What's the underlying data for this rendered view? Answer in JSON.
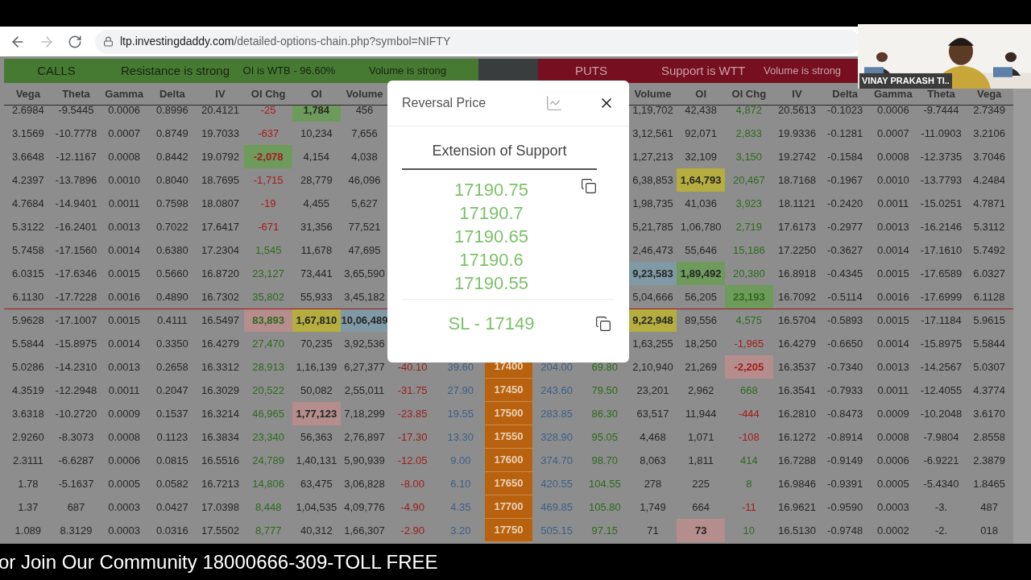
{
  "browser": {
    "url_host": "ltp.investingdaddy.com",
    "url_path": "/detailed-options-chain.php?symbol=NIFTY"
  },
  "calls_bar": [
    "CALLS",
    "Resistance is strong",
    "OI is WTB - 96.60%",
    "Volume is strong"
  ],
  "puts_bar": [
    "PUTS",
    "Support is WTT",
    "Volume is strong"
  ],
  "columns": [
    "Vega",
    "Theta",
    "Gamma",
    "Delta",
    "IV",
    "OI Chg",
    "OI",
    "Volume",
    null,
    null,
    null,
    null,
    null,
    "Volume",
    "OI",
    "OI Chg",
    "IV",
    "Delta",
    "Gamma",
    "Theta",
    "Vega"
  ],
  "rows": [
    {
      "line_above": false,
      "cells": [
        "2.6984",
        "-9.5445",
        "0.0006",
        "0.8996",
        "20.4121",
        {
          "text": "-25",
          "up": false
        },
        {
          "text": "1,784",
          "color": "#6e9a5c"
        },
        "456",
        null,
        null,
        null,
        null,
        null,
        "1,19,702",
        "42,438",
        {
          "text": "4,872",
          "up": true
        },
        "20.5613",
        "-0.1023",
        "0.0006",
        "-9.7444",
        "2.7349"
      ]
    },
    {
      "line_above": false,
      "cells": [
        "3.1569",
        "-10.7778",
        "0.0007",
        "0.8749",
        "19.7033",
        {
          "text": "-637",
          "up": false
        },
        "10,234",
        "7,656",
        null,
        null,
        null,
        null,
        null,
        "3,12,561",
        "92,071",
        {
          "text": "2,833",
          "up": true
        },
        "19.9336",
        "-0.1281",
        "0.0007",
        "-11.0903",
        "3.2106"
      ]
    },
    {
      "line_above": false,
      "cells": [
        "3.6648",
        "-12.1167",
        "0.0008",
        "0.8442",
        "19.0792",
        {
          "text": "-2,078",
          "up": false,
          "color": "#6e9a5c"
        },
        "4,154",
        "4,038",
        null,
        null,
        null,
        null,
        null,
        "1,27,213",
        "32,109",
        {
          "text": "3,150",
          "up": true
        },
        "19.2742",
        "-0.1584",
        "0.0008",
        "-12.3735",
        "3.7046"
      ]
    },
    {
      "line_above": false,
      "cells": [
        "4.2397",
        "-13.7896",
        "0.0010",
        "0.8040",
        "18.7695",
        {
          "text": "-1,715",
          "up": false
        },
        "28,779",
        "46,096",
        null,
        null,
        null,
        null,
        null,
        "6,38,853",
        {
          "text": "1,64,793",
          "color": "#b5ad3f"
        },
        {
          "text": "20,467",
          "up": true
        },
        "18.7168",
        "-0.1967",
        "0.0010",
        "-13.7793",
        "4.2484"
      ]
    },
    {
      "line_above": false,
      "cells": [
        "4.7684",
        "-14.9401",
        "0.0011",
        "0.7598",
        "18.0807",
        {
          "text": "-19",
          "up": false
        },
        "4,455",
        "5,627",
        null,
        null,
        null,
        null,
        null,
        "1,98,735",
        "41,036",
        {
          "text": "3,923",
          "up": true
        },
        "18.1121",
        "-0.2420",
        "0.0011",
        "-15.0251",
        "4.7871"
      ]
    },
    {
      "line_above": false,
      "cells": [
        "5.3122",
        "-16.2401",
        "0.0013",
        "0.7022",
        "17.6417",
        {
          "text": "-671",
          "up": false
        },
        "31,356",
        "77,521",
        null,
        null,
        null,
        null,
        null,
        "5,21,785",
        "1,06,780",
        {
          "text": "2,719",
          "up": true
        },
        "17.6173",
        "-0.2977",
        "0.0013",
        "-16.2146",
        "5.3112"
      ]
    },
    {
      "line_above": false,
      "cells": [
        "5.7458",
        "-17.1560",
        "0.0014",
        "0.6380",
        "17.2304",
        {
          "text": "1,545",
          "up": true
        },
        "11,678",
        "47,695",
        null,
        null,
        null,
        null,
        null,
        "2,46,473",
        "55,646",
        {
          "text": "15,186",
          "up": true
        },
        "17.2250",
        "-0.3627",
        "0.0014",
        "-17.1610",
        "5.7492"
      ]
    },
    {
      "line_above": false,
      "cells": [
        "6.0315",
        "-17.6346",
        "0.0015",
        "0.5660",
        "16.8720",
        {
          "text": "23,127",
          "up": true
        },
        "73,441",
        "3,65,590",
        null,
        null,
        null,
        null,
        null,
        {
          "text": "9,23,583",
          "color": "#7f99a5"
        },
        {
          "text": "1,89,492",
          "color": "#6e9a5c"
        },
        {
          "text": "20,380",
          "up": true
        },
        "16.8918",
        "-0.4345",
        "0.0015",
        "-17.6589",
        "6.0327"
      ]
    },
    {
      "line_above": false,
      "cells": [
        "6.1130",
        "-17.7228",
        "0.0016",
        "0.4890",
        "16.7302",
        {
          "text": "35,802",
          "up": true
        },
        "55,933",
        "3,45,182",
        null,
        null,
        null,
        null,
        null,
        "5,04,666",
        "56,205",
        {
          "text": "23,193",
          "up": true,
          "color": "#6e9a5c"
        },
        "16.7092",
        "-0.5114",
        "0.0016",
        "-17.6999",
        "6.1128"
      ]
    },
    {
      "line_above": true,
      "cells": [
        "5.9628",
        "-17.1007",
        "0.0015",
        "0.4111",
        "16.5497",
        {
          "text": "83,893",
          "up": true,
          "color": "#b58d8d"
        },
        {
          "text": "1,67,810",
          "color": "#b5ad3f"
        },
        {
          "text": "10,06,489",
          "color": "#7f99a5"
        },
        null,
        null,
        null,
        null,
        null,
        {
          "text": "9,22,948",
          "color": "#b5ad3f"
        },
        "89,556",
        {
          "text": "4,575",
          "up": true
        },
        "16.5704",
        "-0.5893",
        "0.0015",
        "-17.1184",
        "5.9615"
      ]
    },
    {
      "line_above": false,
      "cells": [
        "5.5844",
        "-15.8975",
        "0.0014",
        "0.3350",
        "16.4279",
        {
          "text": "27,470",
          "up": true
        },
        "70,235",
        "3,92,536",
        null,
        null,
        null,
        null,
        null,
        "1,63,255",
        "18,250",
        {
          "text": "-1,965",
          "up": false
        },
        "16.4279",
        "-0.6650",
        "0.0014",
        "-15.8975",
        "5.5844"
      ]
    },
    {
      "line_above": false,
      "cells": [
        "5.0286",
        "-14.2310",
        "0.0013",
        "0.2658",
        "16.3312",
        {
          "text": "28,913",
          "up": true
        },
        "1,16,139",
        "6,27,377",
        "-40.10",
        "39.60",
        "17400",
        "204.00",
        "69.80",
        "2,10,940",
        "21,269",
        {
          "text": "-2,205",
          "up": false,
          "color": "#b58d8d"
        },
        "16.3537",
        "-0.7340",
        "0.0013",
        "-14.2567",
        "5.0307"
      ]
    },
    {
      "line_above": false,
      "cells": [
        "4.3519",
        "-12.2948",
        "0.0011",
        "0.2047",
        "16.3029",
        {
          "text": "20,522",
          "up": true
        },
        "50,082",
        "2,55,011",
        "-31.75",
        "27.90",
        "17450",
        "243.60",
        "79.50",
        "23,201",
        "2,962",
        {
          "text": "668",
          "up": true
        },
        "16.3541",
        "-0.7933",
        "0.0011",
        "-12.4055",
        "4.3774"
      ]
    },
    {
      "line_above": false,
      "cells": [
        "3.6318",
        "-10.2720",
        "0.0009",
        "0.1537",
        "16.3214",
        {
          "text": "46,965",
          "up": true
        },
        {
          "text": "1,77,123",
          "color": "#b58d8d"
        },
        "7,18,299",
        "-23.85",
        "19.55",
        "17500",
        "283.85",
        "86.30",
        "63,517",
        "11,944",
        {
          "text": "-444",
          "up": false
        },
        "16.2810",
        "-0.8473",
        "0.0009",
        "-10.2048",
        "3.6170"
      ]
    },
    {
      "line_above": false,
      "cells": [
        "2.9260",
        "-8.3073",
        "0.0008",
        "0.1123",
        "16.3834",
        {
          "text": "23,340",
          "up": true
        },
        "56,363",
        "2,76,897",
        "-17.30",
        "13.30",
        "17550",
        "328.90",
        "95.05",
        "4,468",
        "1,071",
        {
          "text": "-108",
          "up": false
        },
        "16.1272",
        "-0.8914",
        "0.0008",
        "-7.9804",
        "2.8558"
      ]
    },
    {
      "line_above": false,
      "cells": [
        "2.3111",
        "-6.6287",
        "0.0006",
        "0.0815",
        "16.5516",
        {
          "text": "24,789",
          "up": true
        },
        "1,40,131",
        "5,90,939",
        "-12.05",
        "9.00",
        "17600",
        "374.70",
        "98.70",
        "8,063",
        "1,811",
        {
          "text": "414",
          "up": true
        },
        "16.7288",
        "-0.9149",
        "0.0006",
        "-6.9221",
        "2.3879"
      ]
    },
    {
      "line_above": false,
      "cells": [
        "1.78",
        "-5.1637",
        "0.0005",
        "0.0582",
        "16.7213",
        {
          "text": "14,806",
          "up": true
        },
        "63,475",
        "3,06,828",
        "-8.00",
        "6.10",
        "17650",
        "420.55",
        "104.55",
        "278",
        "225",
        {
          "text": "8",
          "up": true
        },
        "16.9846",
        "-0.9391",
        "0.0005",
        "-5.4340",
        "1.8465"
      ]
    },
    {
      "line_above": false,
      "cells": [
        "1.37",
        "687",
        "0.0003",
        "0.0427",
        "17.0398",
        {
          "text": "8,448",
          "up": true
        },
        "1,04,535",
        "4,09,776",
        "-4.90",
        "4.35",
        "17700",
        "469.85",
        "105.80",
        "1,749",
        "664",
        {
          "text": "-11",
          "up": false
        },
        "16.9621",
        "-0.9590",
        "0.0003",
        "-3.",
        "487"
      ]
    },
    {
      "line_above": false,
      "cells": [
        "1.089",
        "8.3129",
        "0.0003",
        "0.0316",
        "17.5502",
        {
          "text": "8,777",
          "up": true
        },
        "40,312",
        "1,66,307",
        "-2.90",
        "3.20",
        "17750",
        "505.15",
        "97.15",
        "71",
        {
          "text": "73",
          "color": "#b58d8d"
        },
        {
          "text": "10",
          "up": true
        },
        "16.5130",
        "-0.9748",
        "0.0002",
        "-2.",
        "018"
      ]
    }
  ],
  "dialog": {
    "title": "Reversal Price",
    "heading": "Extension of Support",
    "prices": [
      "17190.75",
      "17190.7",
      "17190.65",
      "17190.6",
      "17190.55"
    ],
    "stop_loss": "SL - 17149"
  },
  "webcam": {
    "name": "VINAY PRAKASH TI.."
  },
  "ticker": "or Join Our Community 18000666-309-TOLL FREE"
}
